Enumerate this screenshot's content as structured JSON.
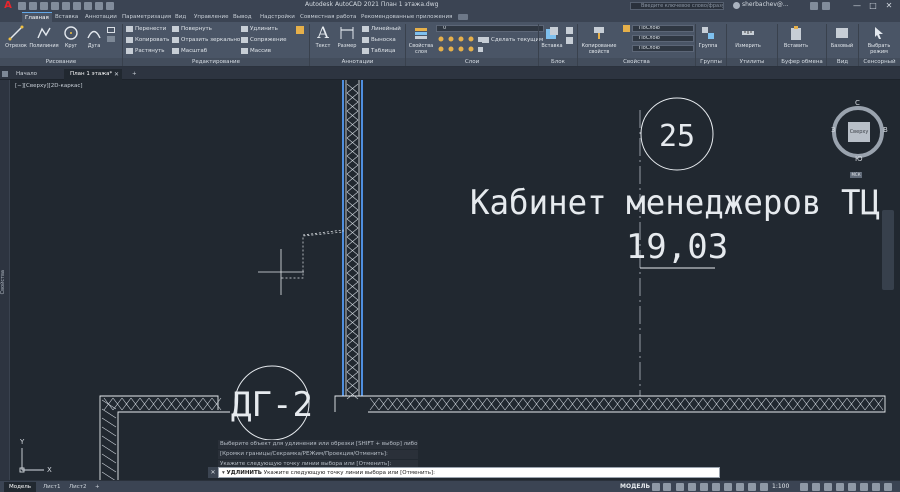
{
  "title": {
    "app_letter": "A",
    "text": "Autodesk AutoCAD 2021   План 1 этажа.dwg",
    "search_placeholder": "Введите ключевое слово/фразу",
    "user": "sherbachev@..."
  },
  "window_buttons": [
    "—",
    "□",
    "✕"
  ],
  "ribbon_tabs": [
    "Главная",
    "Вставка",
    "Аннотации",
    "Параметризация",
    "Вид",
    "Управление",
    "Вывод",
    "Надстройки",
    "Совместная работа",
    "Рекомендованные приложения"
  ],
  "ribbon": {
    "draw": {
      "title": "Рисование",
      "line": "Отрезок",
      "polyline": "Полилиния",
      "circle": "Круг",
      "arc": "Дуга"
    },
    "modify": {
      "title": "Редактирование",
      "move": "Перенести",
      "rotate": "Повернуть",
      "trim": "Удлинить",
      "copy": "Копировать",
      "mirror": "Отразить зеркально",
      "fillet": "Сопряжение",
      "stretch": "Растянуть",
      "scale": "Масштаб",
      "array": "Массив"
    },
    "annotation": {
      "title": "Аннотации",
      "text": "Текст",
      "dimension": "Размер",
      "linear": "Линейный",
      "leader": "Выноска",
      "table": "Таблица"
    },
    "layers": {
      "title": "Слои",
      "props": "Свойства слоя",
      "current_layer": "0",
      "make_current": "Сделать текущим"
    },
    "block": {
      "title": "Блок",
      "insert": "Вставка"
    },
    "properties": {
      "title": "Свойства",
      "match": "Копирование свойств",
      "bylayer1": "ПоСлою",
      "bylayer2": "ПоСлою",
      "bylayer3": "ПоСлою"
    },
    "groups": {
      "title": "Группы",
      "group": "Группа"
    },
    "utilities": {
      "title": "Утилиты",
      "measure": "Измерить"
    },
    "clipboard": {
      "title": "Буфер обмена",
      "paste": "Вставить"
    },
    "view": {
      "title": "Вид",
      "base": "Базовый"
    },
    "touch": {
      "title": "Сенсорный",
      "select_mode": "Выбрать режим"
    }
  },
  "file_tabs": [
    "Начало",
    "План 1 этажа*",
    "+"
  ],
  "palette_label": "Свойства",
  "viewport_label": "[−][Сверху][2D-каркас]",
  "viewcube": {
    "face": "Сверху",
    "north": "С",
    "south": "Ю",
    "west": "З",
    "east": "В",
    "wcs": "МСК"
  },
  "drawing": {
    "room_number": "25",
    "room_name": "Кабинет менеджеров ТЦ",
    "room_area": "19,03",
    "door_tag": "ДГ-2",
    "ucs_y": "Y",
    "ucs_x": "X"
  },
  "command": {
    "history": [
      "Выберите объект для удлинения или обрезки [SHIFT + выбор] либо",
      "[Кромки границы/Секрамка/РЕЖим/Проекция/Отменить]:",
      "Укажите следующую точку линии выбора или [Отменить]:"
    ],
    "prompt_cmd": "УДЛИНИТЬ",
    "prompt_text": "Укажите следующую точку линии выбора или [Отменить]:"
  },
  "status": {
    "tabs": [
      "Модель",
      "Лист1",
      "Лист2",
      "+"
    ],
    "model": "МОДЕЛЬ",
    "scale": "1:100"
  },
  "colors": {
    "accent": "#62a7e8",
    "logo": "#e8262d",
    "canvas": "#212830",
    "wall": "#d6dbe1",
    "selected_wall": "#4f8fe0"
  }
}
